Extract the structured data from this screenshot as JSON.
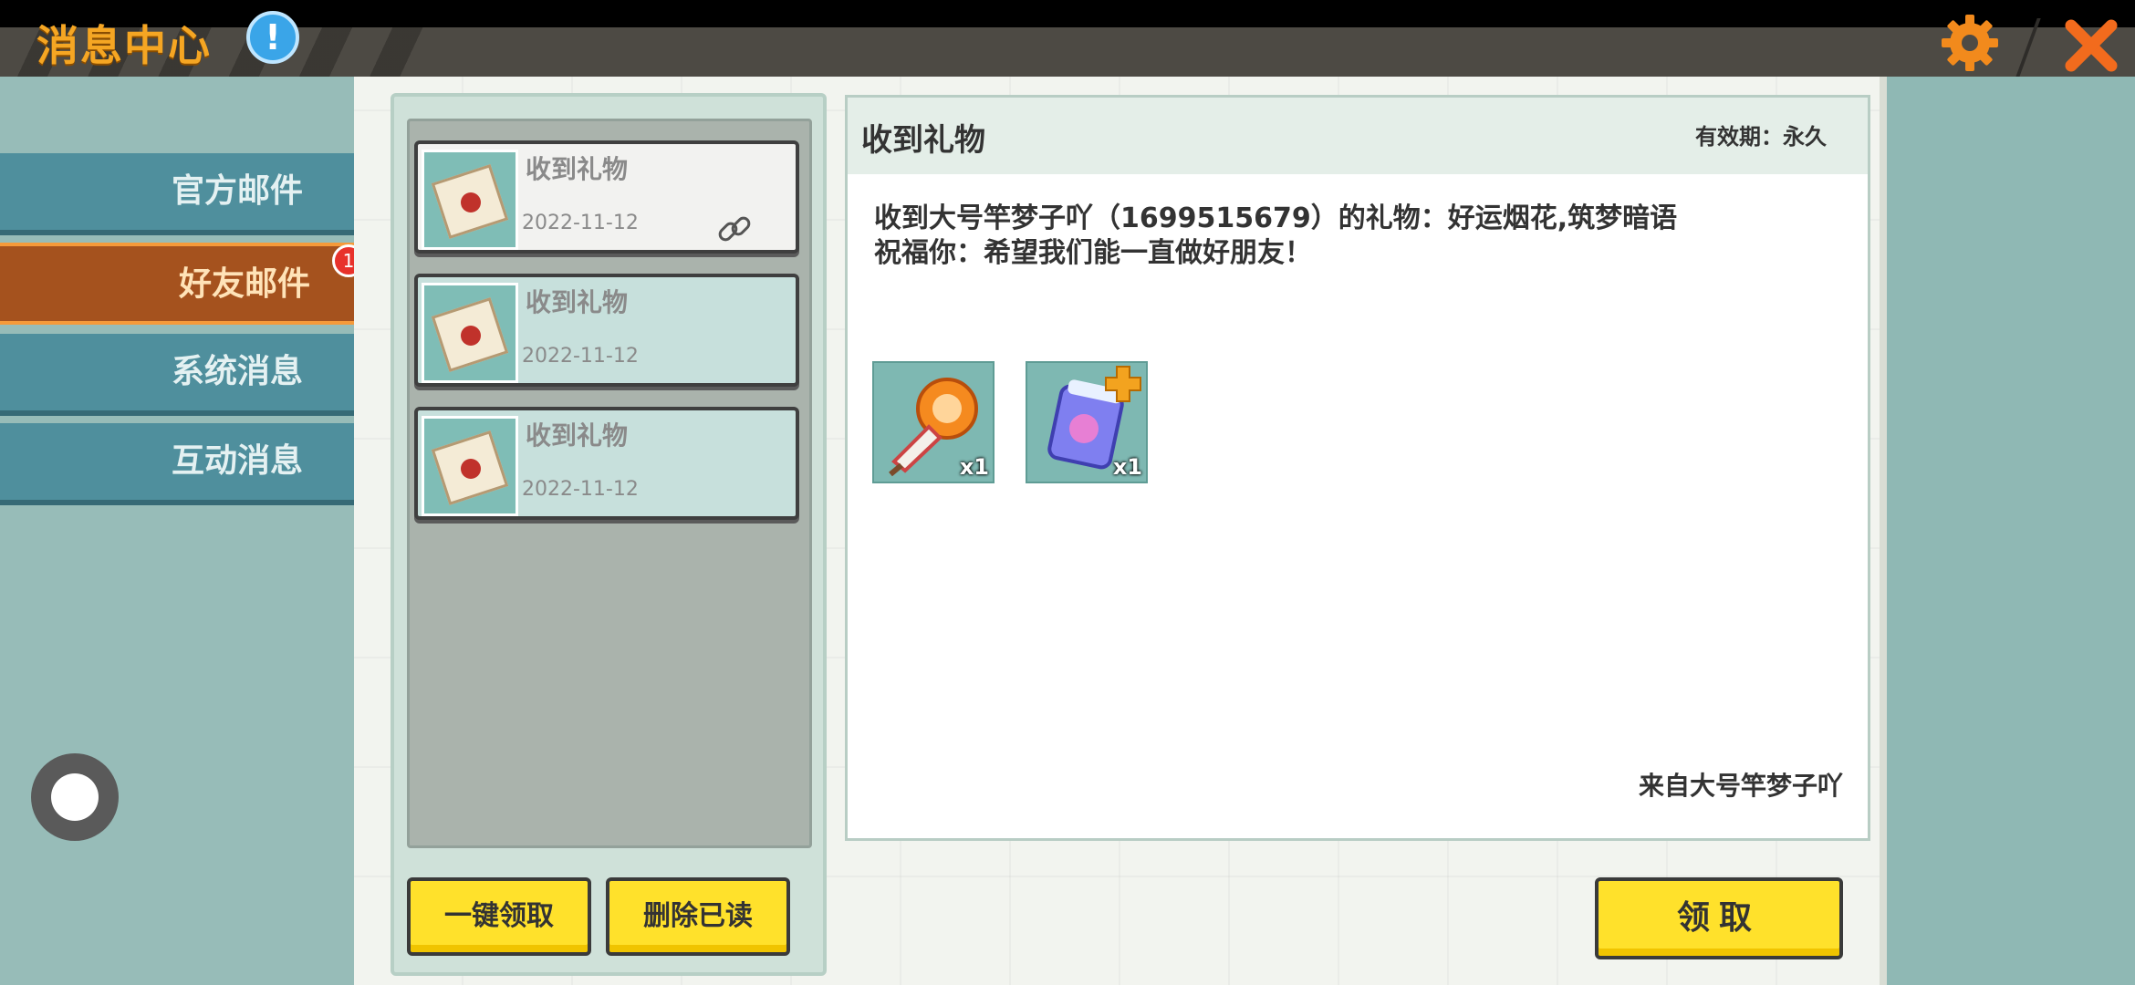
{
  "header": {
    "title": "消息中心"
  },
  "sidebar": {
    "tabs": [
      {
        "label": "官方邮件"
      },
      {
        "label": "好友邮件",
        "badge": "1"
      },
      {
        "label": "系统消息"
      },
      {
        "label": "互动消息"
      }
    ]
  },
  "mail_list": {
    "items": [
      {
        "title": "收到礼物",
        "date": "2022-11-12"
      },
      {
        "title": "收到礼物",
        "date": "2022-11-12"
      },
      {
        "title": "收到礼物",
        "date": "2022-11-12"
      }
    ],
    "claim_all_label": "一键领取",
    "delete_read_label": "删除已读"
  },
  "detail": {
    "title": "收到礼物",
    "validity": "有效期：永久",
    "body_line1": "收到大号竿梦子吖（1699515679）的礼物：好运烟花,筑梦暗语",
    "body_line2": "祝福你：希望我们能一直做好朋友！",
    "gifts": [
      {
        "icon": "firework-icon",
        "qty": "x1"
      },
      {
        "icon": "dream-whisper-card-icon",
        "qty": "x1"
      }
    ],
    "sender": "来自大号竿梦子吖",
    "claim_label": "领取"
  },
  "colors": {
    "accent_orange": "#f5a623",
    "button_yellow": "#ffe12b",
    "tab_teal": "#4f8f9d",
    "tab_active": "#a5521e"
  }
}
